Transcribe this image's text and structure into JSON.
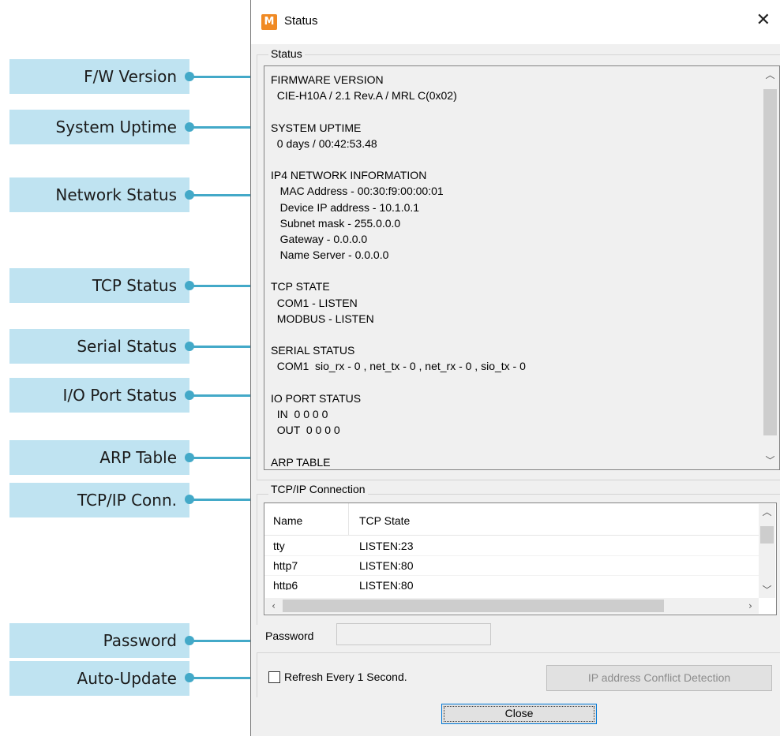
{
  "annotations": [
    {
      "label": "F/W Version"
    },
    {
      "label": "System Uptime"
    },
    {
      "label": "Network Status"
    },
    {
      "label": "TCP Status"
    },
    {
      "label": "Serial Status"
    },
    {
      "label": "I/O Port Status"
    },
    {
      "label": "ARP Table"
    },
    {
      "label": "TCP/IP Conn."
    },
    {
      "label": "Password"
    },
    {
      "label": "Auto-Update"
    }
  ],
  "window": {
    "title": "Status",
    "icon_letter": "M",
    "close_glyph": "✕",
    "accent_color": "#43a9c8",
    "callout_color": "#bfe3f1"
  },
  "status_group": {
    "label": "Status",
    "lines": [
      "FIRMWARE VERSION",
      "  CIE-H10A / 2.1 Rev.A / MRL C(0x02)",
      "",
      "SYSTEM UPTIME",
      "  0 days / 00:42:53.48",
      "",
      "IP4 NETWORK INFORMATION",
      "   MAC Address - 00:30:f9:00:00:01",
      "   Device IP address - 10.1.0.1",
      "   Subnet mask - 255.0.0.0",
      "   Gateway - 0.0.0.0",
      "   Name Server - 0.0.0.0",
      "",
      "TCP STATE",
      "  COM1 - LISTEN",
      "  MODBUS - LISTEN",
      "",
      "SERIAL STATUS",
      "  COM1  sio_rx - 0 , net_tx - 0 , net_rx - 0 , sio_tx - 0",
      "",
      "IO PORT STATUS",
      "  IN  0 0 0 0",
      "  OUT  0 0 0 0",
      "",
      "ARP TABLE"
    ]
  },
  "tcpip_group": {
    "label": "TCP/IP Connection",
    "columns": [
      "Name",
      "TCP State"
    ],
    "rows": [
      [
        "tty",
        "LISTEN:23"
      ],
      [
        "http7",
        "LISTEN:80"
      ],
      [
        "http6",
        "LISTEN:80"
      ]
    ]
  },
  "password": {
    "label": "Password",
    "value": ""
  },
  "auto_update": {
    "label": "Refresh Every 1 Second.",
    "checked": false
  },
  "buttons": {
    "ip_conflict": "IP address Conflict Detection",
    "close": "Close"
  }
}
